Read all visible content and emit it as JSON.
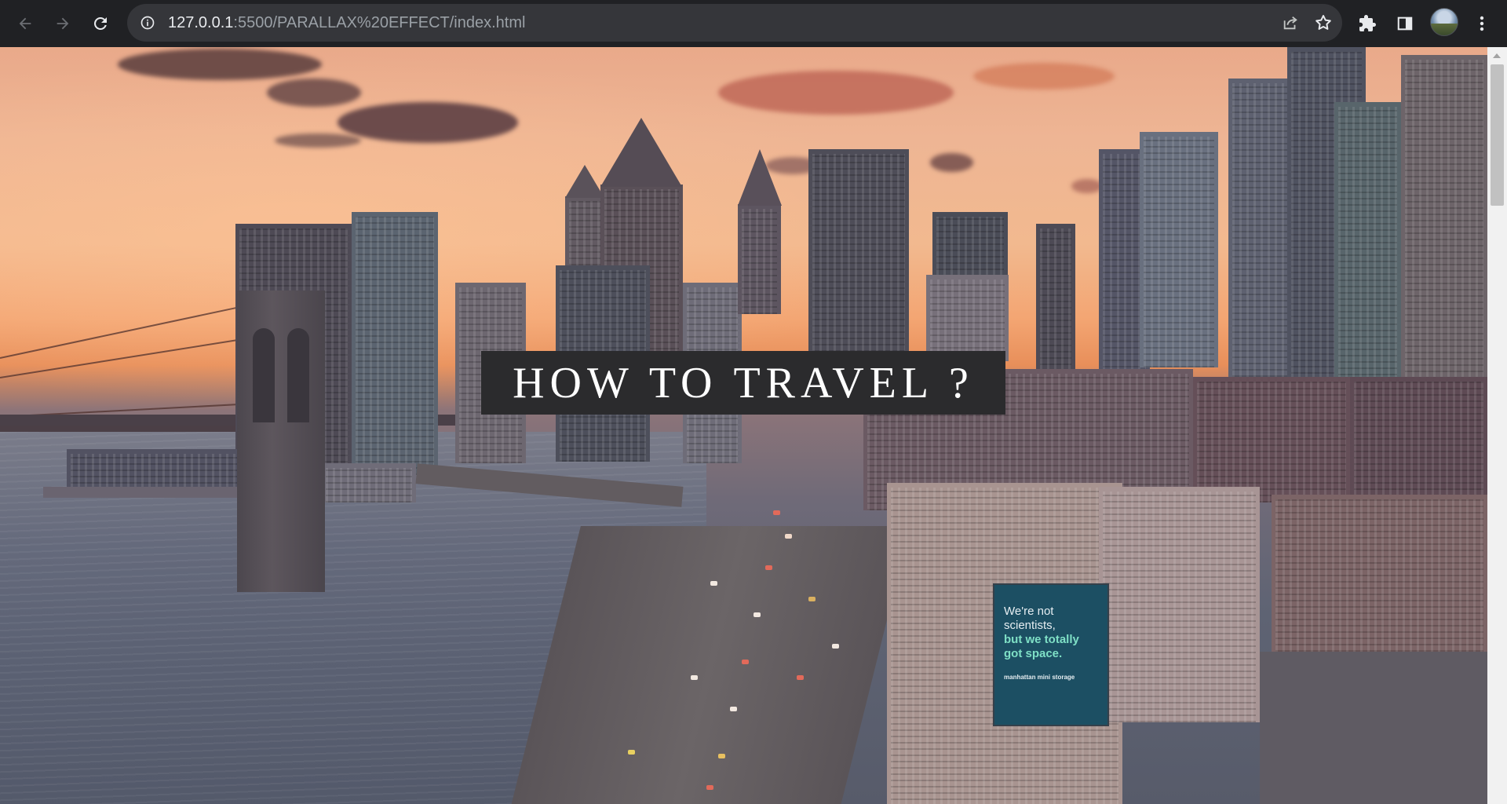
{
  "browser": {
    "url_host": "127.0.0.1",
    "url_path": ":5500/PARALLAX%20EFFECT/index.html",
    "icons": {
      "back": "back-arrow-icon",
      "forward": "forward-arrow-icon",
      "reload": "reload-icon",
      "site_info": "info-icon",
      "share": "share-icon",
      "bookmark": "star-icon",
      "extensions": "puzzle-icon",
      "side_panel": "side-panel-icon",
      "menu": "kebab-menu-icon"
    }
  },
  "page": {
    "title": "HOW TO TRAVEL ?",
    "title_bg": "#2b2b2d",
    "billboard": {
      "line1": "We're not",
      "line2": "scientists,",
      "line3": "but we totally",
      "line4": "got space.",
      "brand": "manhattan mini storage"
    }
  }
}
